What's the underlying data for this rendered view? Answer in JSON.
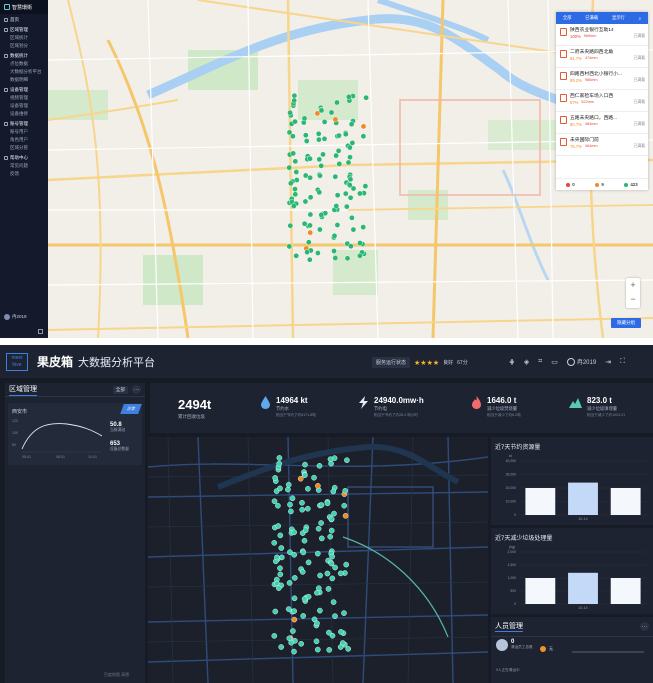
{
  "top": {
    "brand": "智慧環衛",
    "sidebar": [
      {
        "label": "首页",
        "children": []
      },
      {
        "label": "区域管理",
        "children": [
          "区域统计",
          "区域划分"
        ]
      },
      {
        "label": "数据统计",
        "children": [
          "点位数据",
          "大数据分析平台",
          "数据明细"
        ]
      },
      {
        "label": "设备管理",
        "children": [
          "视频管理",
          "设备管理",
          "设备维修"
        ]
      },
      {
        "label": "账号管理",
        "children": [
          "账号用户",
          "角色用户",
          "区域分管"
        ]
      },
      {
        "label": "帮助中心",
        "children": [
          "常见问题",
          "反馈"
        ]
      }
    ],
    "user": "冉2019",
    "panel": {
      "tabs": [
        "全部",
        "已满载",
        "显示行"
      ],
      "items": [
        {
          "name": "陕西农业银行互助14",
          "pct": "100%",
          "dist": "969mm",
          "status": "已满载"
        },
        {
          "name": "二府未央路四西北角",
          "pct": "81.7%",
          "dist": "474mm",
          "status": "已满载"
        },
        {
          "name": "四路西村西北小银行小...",
          "pct": "89.2%",
          "dist": "986mm",
          "status": "已满载"
        },
        {
          "name": "西仁家检车场入口西",
          "pct": "87%",
          "dist": "522mm",
          "status": "已满载"
        },
        {
          "name": "五路未央路口，西路...",
          "pct": "80.7%",
          "dist": "484mm",
          "status": "已满载"
        },
        {
          "name": "未央国际门前",
          "pct": "76.7%",
          "dist": "464mm",
          "status": "已满载"
        }
      ],
      "counts": [
        {
          "color": "#e4473a",
          "value": "0"
        },
        {
          "color": "#f08a24",
          "value": "9"
        },
        {
          "color": "#2bb673",
          "value": "423"
        }
      ]
    },
    "zoom_in": "+",
    "zoom_out": "−",
    "cluster_button": "隐藏分组"
  },
  "bottom": {
    "logo": "meet hive",
    "title": "果皮箱",
    "subtitle": "大数据分析平台",
    "rating_label": "服务运行状态",
    "stars": 4,
    "rating_text": "良好",
    "score": "67分",
    "user": "冉2019",
    "region_panel": {
      "title": "区域管理",
      "button": "全部",
      "city": "西安市",
      "ribbon": "正常",
      "kv": [
        {
          "value": "50.8",
          "label": "当前满溢"
        },
        {
          "value": "653",
          "label": "设备总数量"
        }
      ],
      "axis_x": [
        "05-01",
        "08-01",
        "10-01"
      ],
      "axis_y": [
        "120",
        "100",
        "80"
      ]
    },
    "kpis": {
      "total": {
        "value": "2494t",
        "label": "累计回收垃圾"
      },
      "items": [
        {
          "icon": "water-drop-icon",
          "value": "14964 kt",
          "label": "节约水",
          "sub": "相当于节约了约6171.8吨"
        },
        {
          "icon": "lightning-icon",
          "value": "24940.0mw·h",
          "label": "节约电",
          "sub": "相当于节约了约28.3 吨小时"
        },
        {
          "icon": "flame-icon",
          "value": "1646.0 t",
          "label": "减少垃圾焚烧量",
          "sub": "相当于减少了约8.2吨"
        },
        {
          "icon": "mountain-icon",
          "value": "823.0 t",
          "label": "减少垃圾填埋量",
          "sub": "相当于减少了约1024.21"
        }
      ]
    },
    "charts": [
      {
        "title": "近7天节约资源量"
      },
      {
        "title": "近7天减少垃圾处理量"
      }
    ],
    "people": {
      "title": "人员管理",
      "value": "0",
      "value_label": "清运员工总数",
      "mid": "无",
      "hint": "0人正在清运中"
    },
    "map_attr": "百度地图 高德"
  },
  "chart_data": [
    {
      "type": "bar",
      "title": "近7天节约资源量",
      "ylabel": "kt",
      "yticks": [
        "40,000",
        "30,000",
        "20,000",
        "10,000",
        "0"
      ],
      "ylim": [
        0,
        40000
      ],
      "categories": [
        "",
        "10-14",
        ""
      ],
      "values": [
        20000,
        24000,
        20000
      ]
    },
    {
      "type": "bar",
      "title": "近7天减少垃圾处理量",
      "ylabel": "(kg)",
      "yticks": [
        "2,000",
        "1,500",
        "1,000",
        "500",
        "0"
      ],
      "ylim": [
        0,
        2000
      ],
      "categories": [
        "",
        "10-14",
        ""
      ],
      "values": [
        1000,
        1200,
        1000
      ]
    }
  ]
}
